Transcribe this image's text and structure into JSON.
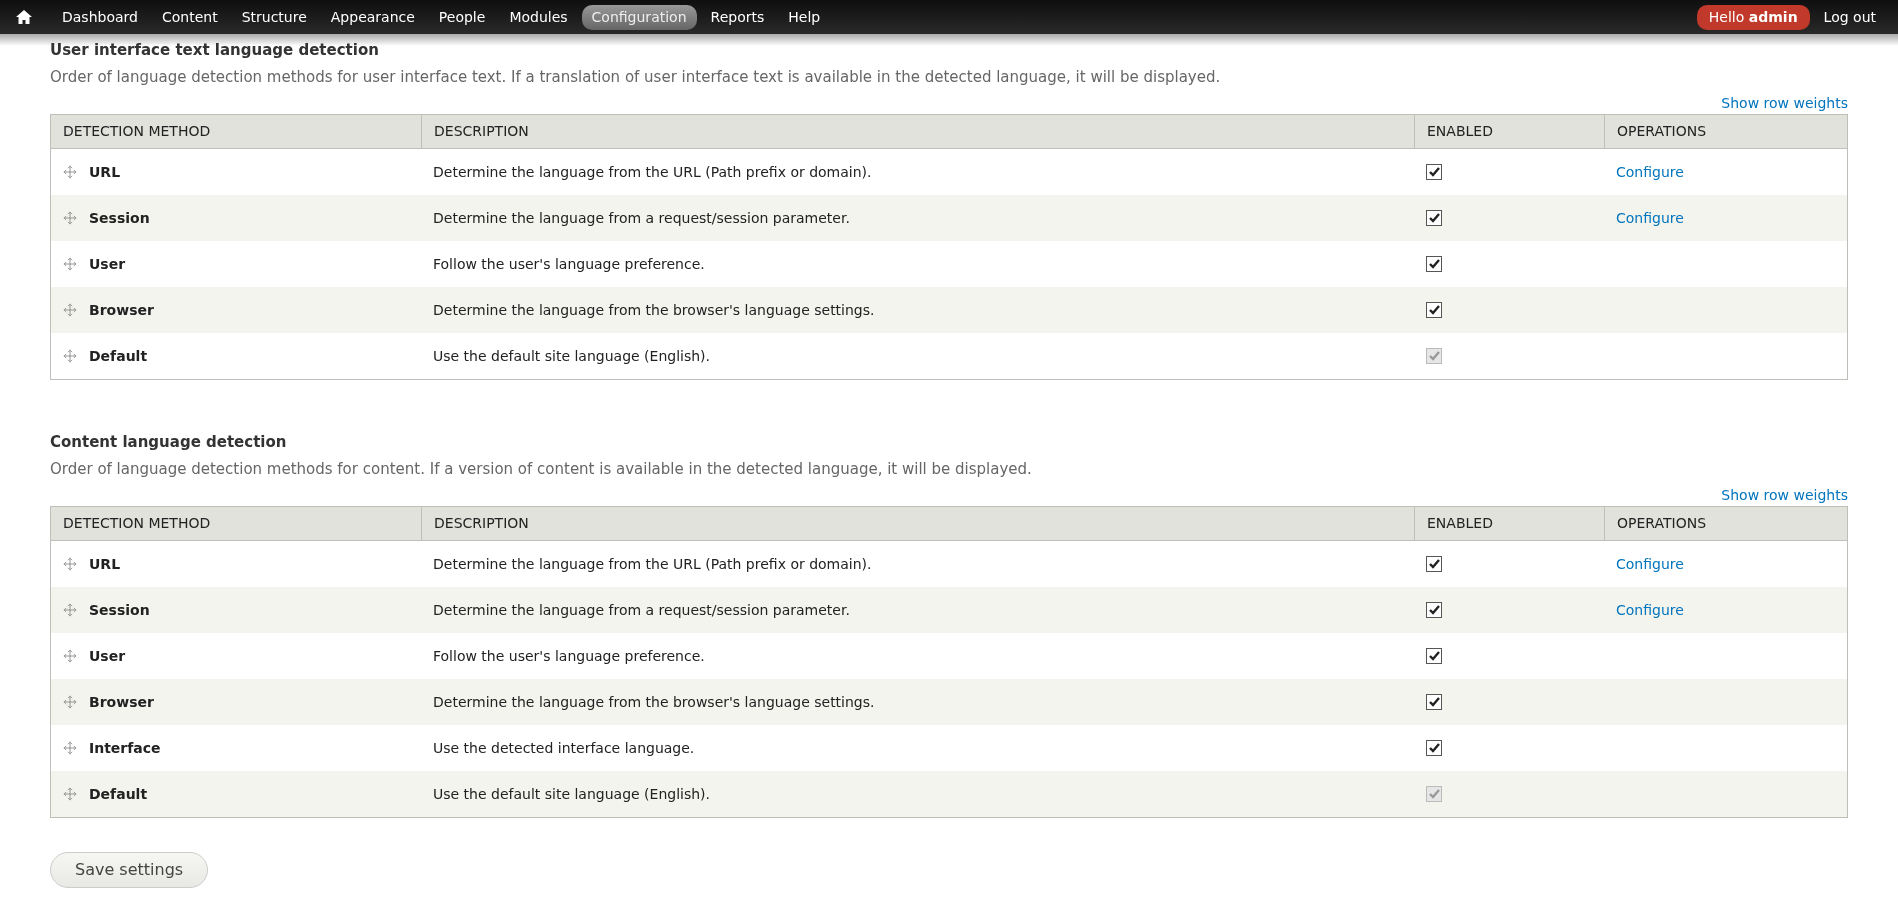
{
  "toolbar": {
    "items": [
      {
        "label": "Dashboard",
        "selected": false
      },
      {
        "label": "Content",
        "selected": false
      },
      {
        "label": "Structure",
        "selected": false
      },
      {
        "label": "Appearance",
        "selected": false
      },
      {
        "label": "People",
        "selected": false
      },
      {
        "label": "Modules",
        "selected": false
      },
      {
        "label": "Configuration",
        "selected": true
      },
      {
        "label": "Reports",
        "selected": false
      },
      {
        "label": "Help",
        "selected": false
      }
    ],
    "greeting": "Hello **admin**",
    "logout": "Log out"
  },
  "sections": [
    {
      "title": "User interface text language detection",
      "description": "Order of language detection methods for user interface text. If a translation of user interface text is available in the detected language, it will be displayed.",
      "toggle_link": "Show row weights",
      "columns": [
        "DETECTION METHOD",
        "DESCRIPTION",
        "ENABLED",
        "OPERATIONS"
      ],
      "rows": [
        {
          "method": "URL",
          "description": "Determine the language from the URL (Path prefix or domain).",
          "enabled": true,
          "disabled": false,
          "operation": "Configure"
        },
        {
          "method": "Session",
          "description": "Determine the language from a request/session parameter.",
          "enabled": true,
          "disabled": false,
          "operation": "Configure"
        },
        {
          "method": "User",
          "description": "Follow the user's language preference.",
          "enabled": true,
          "disabled": false
        },
        {
          "method": "Browser",
          "description": "Determine the language from the browser's language settings.",
          "enabled": true,
          "disabled": false
        },
        {
          "method": "Default",
          "description": "Use the default site language (English).",
          "enabled": true,
          "disabled": true
        }
      ]
    },
    {
      "title": "Content language detection",
      "description": "Order of language detection methods for content. If a version of content is available in the detected language, it will be displayed.",
      "toggle_link": "Show row weights",
      "columns": [
        "DETECTION METHOD",
        "DESCRIPTION",
        "ENABLED",
        "OPERATIONS"
      ],
      "rows": [
        {
          "method": "URL",
          "description": "Determine the language from the URL (Path prefix or domain).",
          "enabled": true,
          "disabled": false,
          "operation": "Configure"
        },
        {
          "method": "Session",
          "description": "Determine the language from a request/session parameter.",
          "enabled": true,
          "disabled": false,
          "operation": "Configure"
        },
        {
          "method": "User",
          "description": "Follow the user's language preference.",
          "enabled": true,
          "disabled": false
        },
        {
          "method": "Browser",
          "description": "Determine the language from the browser's language settings.",
          "enabled": true,
          "disabled": false
        },
        {
          "method": "Interface",
          "description": "Use the detected interface language.",
          "enabled": true,
          "disabled": false
        },
        {
          "method": "Default",
          "description": "Use the default site language (English).",
          "enabled": true,
          "disabled": true
        }
      ]
    }
  ],
  "save_button": "Save settings"
}
